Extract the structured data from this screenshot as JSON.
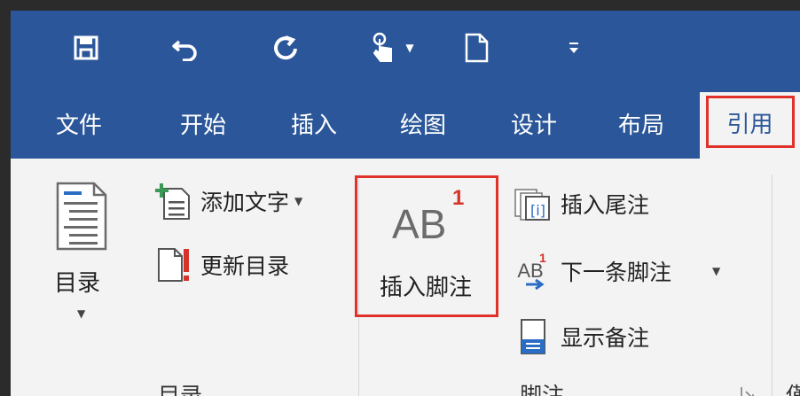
{
  "quick_access": {
    "icons": [
      "save-icon",
      "undo-icon",
      "redo-icon",
      "touch-mode-icon",
      "new-document-icon",
      "customize-qat-icon"
    ]
  },
  "tabs": [
    {
      "label": "文件",
      "active": false
    },
    {
      "label": "开始",
      "active": false
    },
    {
      "label": "插入",
      "active": false
    },
    {
      "label": "绘图",
      "active": false
    },
    {
      "label": "设计",
      "active": false
    },
    {
      "label": "布局",
      "active": false
    },
    {
      "label": "引用",
      "active": true
    }
  ],
  "ribbon": {
    "toc_group": {
      "toc_button_label": "目录",
      "add_text_label": "添加文字",
      "update_toc_label": "更新目录",
      "group_label": "目录"
    },
    "footnotes_group": {
      "insert_footnote_glyph": "AB",
      "insert_footnote_superscript": "1",
      "insert_footnote_label": "插入脚注",
      "insert_endnote_label": "插入尾注",
      "next_footnote_glyph": "AB",
      "next_footnote_superscript": "1",
      "next_footnote_label": "下一条脚注",
      "show_notes_label": "显示备注",
      "group_label": "脚注"
    },
    "next_group_label_partial": "僅"
  },
  "colors": {
    "ribbon_blue": "#2b579a",
    "highlight_red": "#e0312b",
    "ribbon_bg": "#f3f3f3"
  }
}
